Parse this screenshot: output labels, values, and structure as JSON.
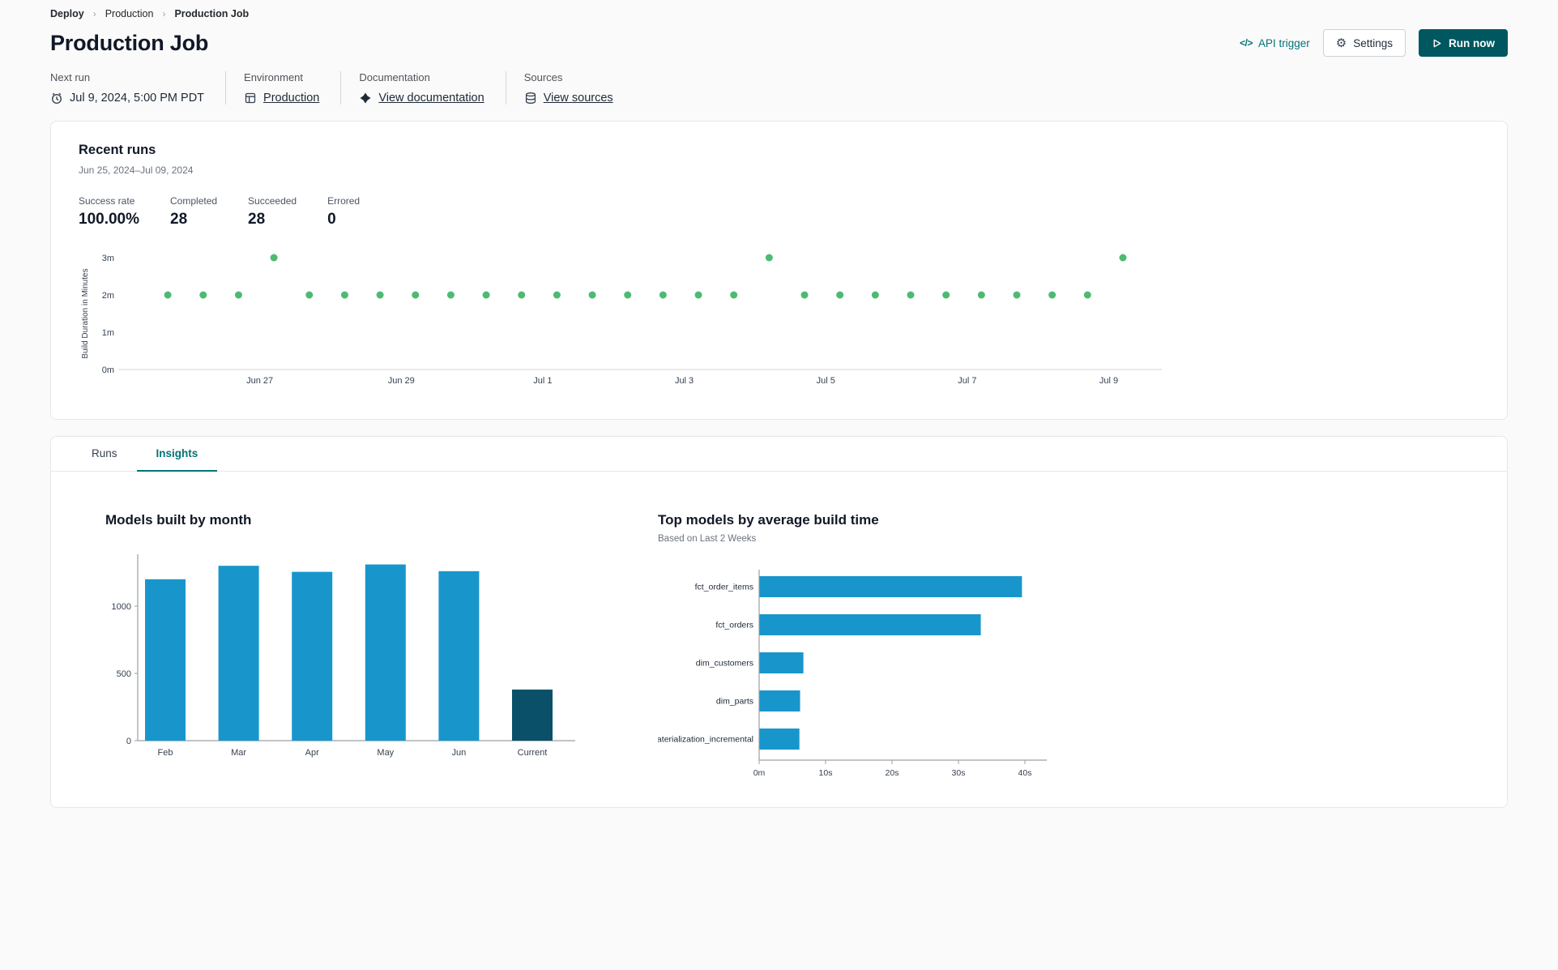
{
  "theme": {
    "accent": "#047377",
    "accent-dark": "#00575f",
    "page-bg": "#fafafa"
  },
  "icons": {
    "code": "</>",
    "gear": "⚙",
    "breadcrumb_separator": "›"
  },
  "breadcrumb": {
    "items": [
      "Deploy",
      "Production",
      "Production Job"
    ]
  },
  "header": {
    "title": "Production Job",
    "api_trigger_label": "API trigger",
    "settings_label": "Settings",
    "run_now_label": "Run now"
  },
  "info_bar": {
    "next_run": {
      "label": "Next run",
      "value": "Jul 9, 2024, 5:00 PM PDT"
    },
    "environment": {
      "label": "Environment",
      "value": "Production"
    },
    "documentation": {
      "label": "Documentation",
      "value": "View documentation"
    },
    "sources": {
      "label": "Sources",
      "value": "View sources"
    }
  },
  "recent_runs": {
    "title": "Recent runs",
    "date_range": "Jun 25, 2024–Jul 09, 2024",
    "stats": [
      {
        "label": "Success rate",
        "value": "100.00%"
      },
      {
        "label": "Completed",
        "value": "28"
      },
      {
        "label": "Succeeded",
        "value": "28"
      },
      {
        "label": "Errored",
        "value": "0"
      }
    ]
  },
  "tabs": [
    {
      "label": "Runs",
      "active": false
    },
    {
      "label": "Insights",
      "active": true
    }
  ],
  "chart_data": [
    {
      "name": "recent-runs-build-duration",
      "type": "scatter",
      "ylabel": "Build Duration in Minutes",
      "y_ticks": [
        "0m",
        "1m",
        "2m",
        "3m"
      ],
      "ylim_minutes": [
        0,
        3.3
      ],
      "x_range_days": [
        0,
        14.75
      ],
      "x_ticks": [
        {
          "label": "Jun 27",
          "day": 2
        },
        {
          "label": "Jun 29",
          "day": 4
        },
        {
          "label": "Jul 1",
          "day": 6
        },
        {
          "label": "Jul 3",
          "day": 8
        },
        {
          "label": "Jul 5",
          "day": 10
        },
        {
          "label": "Jul 7",
          "day": 12
        },
        {
          "label": "Jul 9",
          "day": 14
        }
      ],
      "point_color": "#4cbb71",
      "points": [
        {
          "day": 0.7,
          "min": 2
        },
        {
          "day": 1.2,
          "min": 2
        },
        {
          "day": 1.7,
          "min": 2
        },
        {
          "day": 2.2,
          "min": 3
        },
        {
          "day": 2.7,
          "min": 2
        },
        {
          "day": 3.2,
          "min": 2
        },
        {
          "day": 3.7,
          "min": 2
        },
        {
          "day": 4.2,
          "min": 2
        },
        {
          "day": 4.7,
          "min": 2
        },
        {
          "day": 5.2,
          "min": 2
        },
        {
          "day": 5.7,
          "min": 2
        },
        {
          "day": 6.2,
          "min": 2
        },
        {
          "day": 6.7,
          "min": 2
        },
        {
          "day": 7.2,
          "min": 2
        },
        {
          "day": 7.7,
          "min": 2
        },
        {
          "day": 8.2,
          "min": 2
        },
        {
          "day": 8.7,
          "min": 2
        },
        {
          "day": 9.2,
          "min": 3
        },
        {
          "day": 9.7,
          "min": 2
        },
        {
          "day": 10.2,
          "min": 2
        },
        {
          "day": 10.7,
          "min": 2
        },
        {
          "day": 11.2,
          "min": 2
        },
        {
          "day": 11.7,
          "min": 2
        },
        {
          "day": 12.2,
          "min": 2
        },
        {
          "day": 12.7,
          "min": 2
        },
        {
          "day": 13.2,
          "min": 2
        },
        {
          "day": 13.7,
          "min": 2
        },
        {
          "day": 14.2,
          "min": 3
        }
      ]
    },
    {
      "name": "models-built-by-month",
      "type": "bar",
      "title": "Models built by month",
      "categories": [
        "Feb",
        "Mar",
        "Apr",
        "May",
        "Jun",
        "Current"
      ],
      "values": [
        1200,
        1300,
        1255,
        1310,
        1260,
        380
      ],
      "colors": [
        "#1896cc",
        "#1896cc",
        "#1896cc",
        "#1896cc",
        "#1896cc",
        "#0a5068"
      ],
      "y_ticks": [
        0,
        500,
        1000
      ],
      "ylim": [
        0,
        1400
      ]
    },
    {
      "name": "top-models-by-average-build-time",
      "type": "bar-horizontal",
      "title": "Top models by average build time",
      "subtitle": "Based on Last 2 Weeks",
      "categories": [
        "fct_order_items",
        "fct_orders",
        "dim_customers",
        "dim_parts",
        "materialization_incremental"
      ],
      "values_seconds": [
        39.5,
        33.3,
        6.6,
        6.1,
        6.0
      ],
      "bar_color": "#1896cc",
      "x_ticks": [
        "0m",
        "10s",
        "20s",
        "30s",
        "40s"
      ],
      "xlim_seconds": [
        0,
        43
      ]
    }
  ]
}
